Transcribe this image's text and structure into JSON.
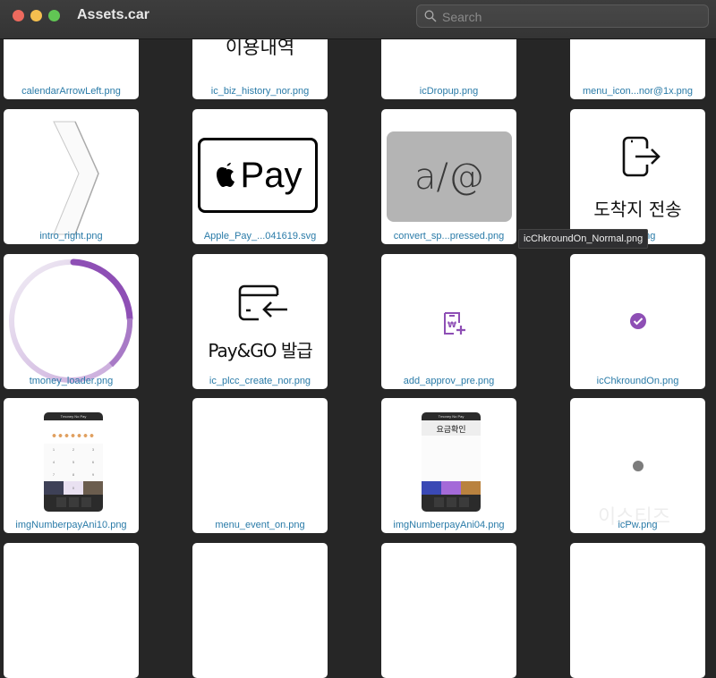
{
  "window": {
    "title": "Assets.car",
    "search_placeholder": "Search",
    "search_value": ""
  },
  "tooltip": "icChkroundOn_Normal.png",
  "assets": [
    {
      "name": "calendarArrowLeft.png",
      "preview": "circle-arrow-partial"
    },
    {
      "name": "ic_biz_history_nor.png",
      "preview_text": "이용내역"
    },
    {
      "name": "icDropup.png",
      "preview": "blank"
    },
    {
      "name": "menu_icon...nor@1x.png",
      "preview": "blank"
    },
    {
      "name": "intro_right.png",
      "preview": "chevron-right"
    },
    {
      "name": "Apple_Pay_...041619.svg",
      "preview_text": "Pay"
    },
    {
      "name": "convert_sp...pressed.png",
      "preview_text": "a/@"
    },
    {
      "name": "...or.png",
      "preview_text": "도착지 전송"
    },
    {
      "name": "tmoney_loader.png",
      "preview": "loader-ring"
    },
    {
      "name": "ic_plcc_create_nor.png",
      "preview_text": "Pay&GO 발급"
    },
    {
      "name": "add_approv_pre.png",
      "preview": "receipt-add-icon"
    },
    {
      "name": "icChkroundOn.png",
      "preview": "check-circle"
    },
    {
      "name": "imgNumberpayAni10.png",
      "preview": "phone-keypad",
      "phone_header": "Tmoney No Pay"
    },
    {
      "name": "menu_event_on.png",
      "preview": "blank"
    },
    {
      "name": "imgNumberpayAni04.png",
      "preview": "phone-fare",
      "phone_header": "Tmoney No Pay",
      "phone_title": "요금확인"
    },
    {
      "name": "icPw.png",
      "preview": "dot"
    }
  ],
  "colors": {
    "accent_purple": "#8e4fb5",
    "label_blue": "#2a7ba8"
  },
  "watermark": "이스티즈"
}
